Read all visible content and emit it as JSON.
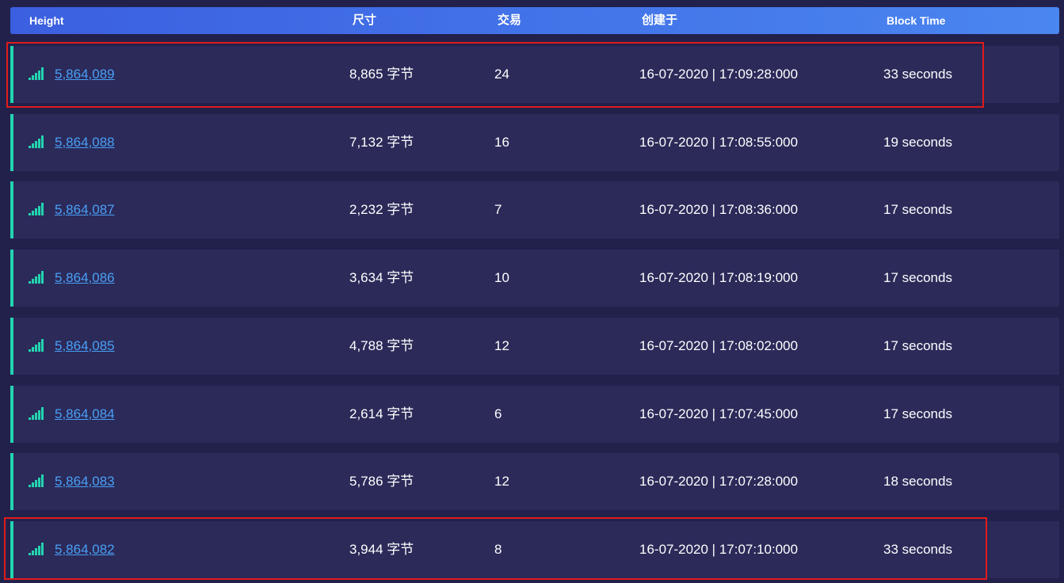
{
  "table": {
    "headers": {
      "height": "Height",
      "size": "尺寸",
      "transactions": "交易",
      "created": "创建于",
      "block_time": "Block Time"
    },
    "rows": [
      {
        "height": "5,864,089",
        "size": "8,865 字节",
        "transactions": "24",
        "created": "16-07-2020 | 17:09:28:000",
        "block_time": "33 seconds",
        "highlighted": true
      },
      {
        "height": "5,864,088",
        "size": "7,132 字节",
        "transactions": "16",
        "created": "16-07-2020 | 17:08:55:000",
        "block_time": "19 seconds",
        "highlighted": false
      },
      {
        "height": "5,864,087",
        "size": "2,232 字节",
        "transactions": "7",
        "created": "16-07-2020 | 17:08:36:000",
        "block_time": "17 seconds",
        "highlighted": false
      },
      {
        "height": "5,864,086",
        "size": "3,634 字节",
        "transactions": "10",
        "created": "16-07-2020 | 17:08:19:000",
        "block_time": "17 seconds",
        "highlighted": false
      },
      {
        "height": "5,864,085",
        "size": "4,788 字节",
        "transactions": "12",
        "created": "16-07-2020 | 17:08:02:000",
        "block_time": "17 seconds",
        "highlighted": false
      },
      {
        "height": "5,864,084",
        "size": "2,614 字节",
        "transactions": "6",
        "created": "16-07-2020 | 17:07:45:000",
        "block_time": "17 seconds",
        "highlighted": false
      },
      {
        "height": "5,864,083",
        "size": "5,786 字节",
        "transactions": "12",
        "created": "16-07-2020 | 17:07:28:000",
        "block_time": "18 seconds",
        "highlighted": false
      },
      {
        "height": "5,864,082",
        "size": "3,944 字节",
        "transactions": "8",
        "created": "16-07-2020 | 17:07:10:000",
        "block_time": "33 seconds",
        "highlighted": true
      }
    ],
    "row_icon": "signal-bars-icon"
  },
  "colors": {
    "background": "#22214c",
    "row_background": "#2b2a59",
    "accent": "#23d4b0",
    "link": "#4a9ff5",
    "highlight_box": "#e01b1b"
  }
}
